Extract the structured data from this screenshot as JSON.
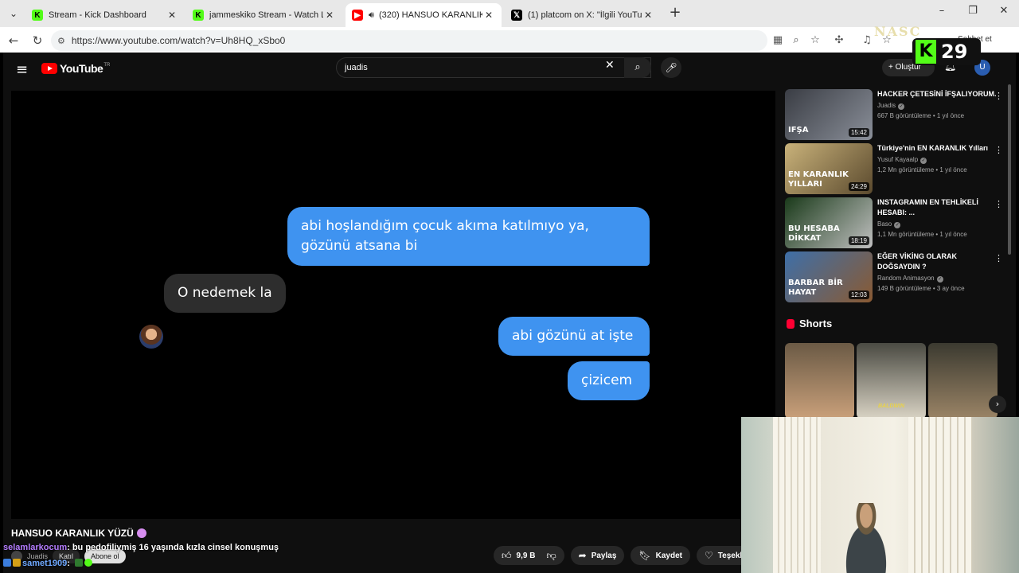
{
  "browser": {
    "tabs": [
      {
        "favicon": "kick-icon",
        "title": "Stream - Kick Dashboard",
        "active": false
      },
      {
        "favicon": "kick-icon",
        "title": "jammeskiko Stream - Watch Live o",
        "active": false
      },
      {
        "favicon": "youtube-icon",
        "title": "(320) HANSUO KARANLIK YÜZ",
        "active": true,
        "audio": true
      },
      {
        "favicon": "x-icon",
        "title": "(1) platcom on X: \"İlgili YouTube v",
        "active": false
      }
    ],
    "url": "https://www.youtube.com/watch?v=Uh8HQ_xSbo0",
    "chat_button_label": "Sohbet et"
  },
  "youtube": {
    "logo_text": "YouTube",
    "country_code": "TR",
    "search_value": "juadis",
    "create_label": "Oluştur",
    "avatar_letter": "U"
  },
  "video": {
    "messages": [
      {
        "side": "out",
        "text": "abi hoşlandığım çocuk akıma katılmıyo ya, gözünü atsana bi"
      },
      {
        "side": "in",
        "text": "O nedemek la"
      },
      {
        "side": "out",
        "text": "abi gözünü at işte"
      },
      {
        "side": "out",
        "text": "çizicem"
      }
    ],
    "title": "HANSUO KARANLIK YÜZÜ",
    "channel": "Juadis",
    "join_label": "Katıl",
    "subscribe_label": "Abone ol",
    "likes": "9,9 B",
    "share_label": "Paylaş",
    "save_label": "Kaydet",
    "thanks_label": "Teşekkürle"
  },
  "sidebar": {
    "recommendations": [
      {
        "title": "HACKER ÇETESİNİ İFŞALIYORUM.",
        "channel": "Juadis",
        "views": "667 B görüntüleme • 1 yıl önce",
        "duration": "15:42",
        "thumb_text": "IFŞA",
        "thumb_colors": [
          "#3a3d44",
          "#8a8f99"
        ]
      },
      {
        "title": "Türkiye'nin EN KARANLIK Yılları",
        "channel": "Yusuf Kayaalp",
        "views": "1,2 Mn görüntüleme • 1 yıl önce",
        "duration": "24:29",
        "thumb_text": "EN KARANLIK YILLARI",
        "thumb_colors": [
          "#c9b27a",
          "#5b4a2e"
        ]
      },
      {
        "title": "INSTAGRAMIN EN TEHLİKELİ HESABI: ...",
        "channel": "Baso",
        "views": "1,1 Mn görüntüleme • 1 yıl önce",
        "duration": "18:19",
        "thumb_text": "BU HESABA DİKKAT",
        "thumb_colors": [
          "#1a3a1a",
          "#c0c0c0"
        ]
      },
      {
        "title": "EĞER VİKİNG OLARAK DOĞSAYDIN ?",
        "channel": "Random Animasyon",
        "views": "149 B görüntüleme • 3 ay önce",
        "duration": "12:03",
        "thumb_text": "BARBAR BİR HAYAT",
        "thumb_colors": [
          "#3e6fa8",
          "#8a5a32"
        ]
      }
    ],
    "shorts_label": "Shorts",
    "shorts": [
      {
        "colors": [
          "#6b5a45",
          "#c9a07a"
        ],
        "caption": ""
      },
      {
        "colors": [
          "#4a4a42",
          "#d9d3c4"
        ],
        "caption": "BALDWIN"
      },
      {
        "colors": [
          "#3b3a30",
          "#9a8466"
        ],
        "caption": ""
      }
    ]
  },
  "overlays": {
    "kick_letter": "K",
    "kick_number": "29",
    "watermark": "NASC",
    "chat": [
      {
        "user": "selamlarkocum",
        "message": ": bu pedofiliymiş 16 yaşında kızla cinsel konuşmuş"
      },
      {
        "user": "samet1909",
        "message": ":"
      }
    ]
  }
}
